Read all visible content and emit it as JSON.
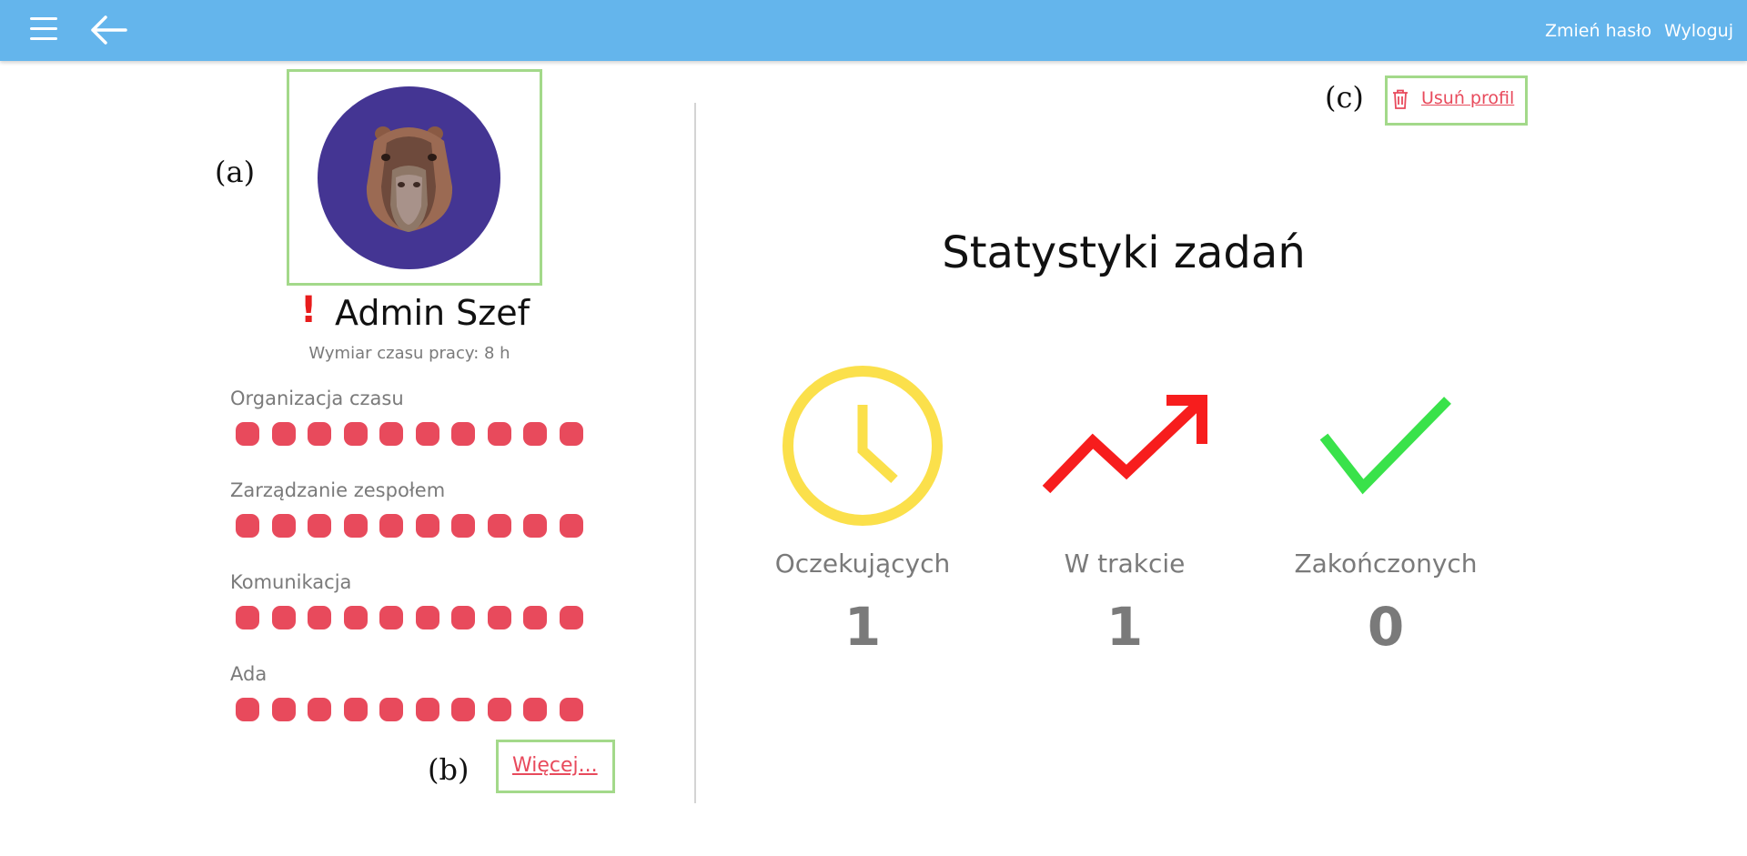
{
  "topbar": {
    "color": "#64b5ec",
    "menu_icon": "hamburger-menu-icon",
    "back_icon": "back-arrow-icon",
    "change_password_label": "Zmień hasło",
    "logout_label": "Wyloguj"
  },
  "callouts": {
    "a": "(a)",
    "b": "(b)",
    "c": "(c)"
  },
  "profile": {
    "avatar_icon": "capybara-avatar-icon",
    "avatar_bg": "#443593",
    "alert_symbol": "!",
    "name": "Admin Szef",
    "work_hours": "Wymiar czasu pracy: 8 h"
  },
  "skills": [
    {
      "label": "Organizacja czasu",
      "rating": 10,
      "max": 10
    },
    {
      "label": "Zarządzanie zespołem",
      "rating": 10,
      "max": 10
    },
    {
      "label": "Komunikacja",
      "rating": 10,
      "max": 10
    },
    {
      "label": "Ada",
      "rating": 10,
      "max": 10
    }
  ],
  "more_label": "Więcej...",
  "delete_profile": {
    "icon": "trash-icon",
    "label": "Usuń profil",
    "color": "#e84a5c"
  },
  "stats": {
    "title": "Statystyki zadań",
    "items": [
      {
        "icon": "clock-icon",
        "color": "#fbe04b",
        "label": "Oczekujących",
        "value": "1"
      },
      {
        "icon": "trending-up-icon",
        "color": "#f71d1d",
        "label": "W trakcie",
        "value": "1"
      },
      {
        "icon": "check-icon",
        "color": "#39e24a",
        "label": "Zakończonych",
        "value": "0"
      }
    ]
  }
}
